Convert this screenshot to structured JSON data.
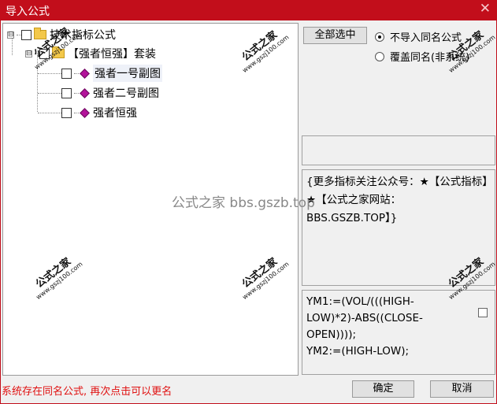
{
  "window": {
    "title": "导入公式",
    "close_glyph": "✕"
  },
  "tree": {
    "root": {
      "label": "技术指标公式",
      "expander": "⊟"
    },
    "package": {
      "label": "【强者恒强】套装",
      "expander": "⊟"
    },
    "items": [
      {
        "label": "强者一号副图"
      },
      {
        "label": "强者二号副图"
      },
      {
        "label": "强者恒强"
      }
    ]
  },
  "controls": {
    "select_all": "全部选中",
    "radio_no_import": "不导入同名公式",
    "radio_overwrite": "覆盖同名(非系统)"
  },
  "description": "{更多指标关注公众号：★【公式指标】★【公式之家网站：BBS.GSZB.TOP】}",
  "code_lines": [
    "YM1:=(VOL/(((HIGH-",
    "LOW)*2)-ABS((CLOSE-",
    "OPEN))));",
    "YM2:=(HIGH-LOW);"
  ],
  "status": "系统存在同名公式, 再次点击可以更名",
  "buttons": {
    "ok": "确定",
    "cancel": "取消"
  },
  "watermark": {
    "main": "公式之家",
    "url": "www.gszj100.com",
    "center": "公式之家 bbs.gszb.top"
  },
  "colors": {
    "titlebar": "#c20e1b",
    "status": "#e01010"
  }
}
